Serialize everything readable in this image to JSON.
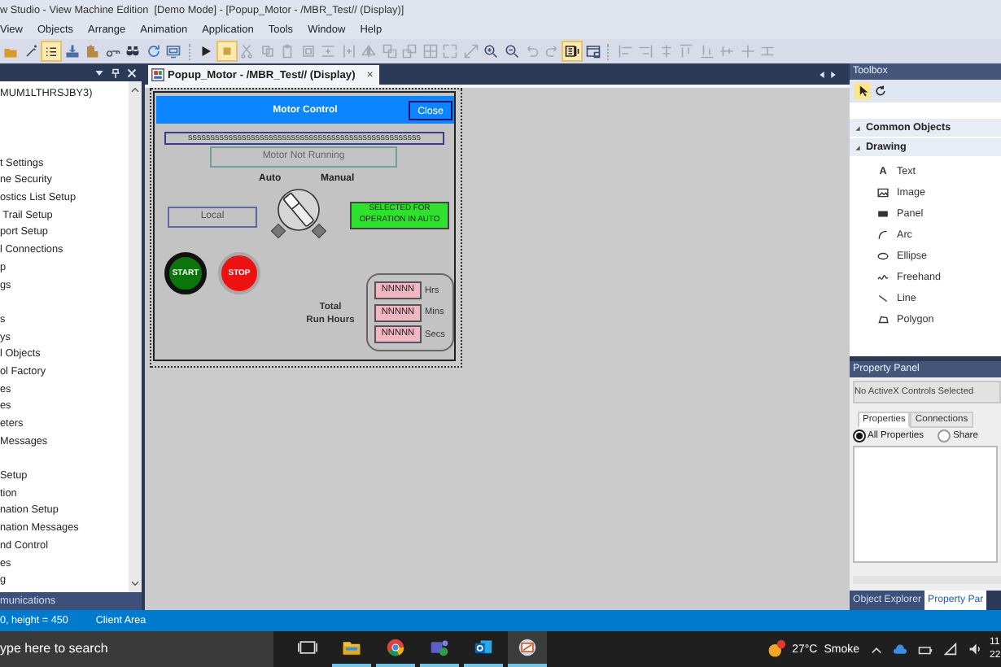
{
  "window": {
    "title": "w Studio - View Machine Edition  [Demo Mode] - [Popup_Motor - /MBR_Test// (Display)]"
  },
  "menu": [
    "View",
    "Objects",
    "Arrange",
    "Animation",
    "Application",
    "Tools",
    "Window",
    "Help"
  ],
  "toolbar_groups": [
    {
      "buttons": [
        {
          "kind": "folder",
          "selected": false,
          "disabled": false
        },
        {
          "kind": "wand",
          "selected": false,
          "disabled": false
        },
        {
          "kind": "list",
          "selected": true,
          "disabled": false
        },
        {
          "kind": "import",
          "selected": false,
          "disabled": false
        },
        {
          "kind": "clipboard",
          "selected": false,
          "disabled": false
        },
        {
          "kind": "key",
          "selected": false,
          "disabled": false
        },
        {
          "kind": "binoculars",
          "selected": false,
          "disabled": false
        },
        {
          "kind": "refresh",
          "selected": false,
          "disabled": false
        },
        {
          "kind": "screen",
          "selected": false,
          "disabled": false
        }
      ]
    },
    {
      "buttons": [
        {
          "kind": "play",
          "selected": false,
          "disabled": false
        },
        {
          "kind": "stop",
          "selected": true,
          "disabled": false
        },
        {
          "kind": "scissors",
          "selected": false,
          "disabled": true
        },
        {
          "kind": "copy",
          "selected": false,
          "disabled": true
        },
        {
          "kind": "paste",
          "selected": false,
          "disabled": true
        },
        {
          "kind": "frame",
          "selected": false,
          "disabled": true
        },
        {
          "kind": "vertical-spacing",
          "selected": false,
          "disabled": true
        },
        {
          "kind": "horizontal-spacing",
          "selected": false,
          "disabled": true
        },
        {
          "kind": "flip",
          "selected": false,
          "disabled": true
        },
        {
          "kind": "bring-front",
          "selected": false,
          "disabled": true
        },
        {
          "kind": "send-back",
          "selected": false,
          "disabled": true
        },
        {
          "kind": "grid",
          "selected": false,
          "disabled": true
        },
        {
          "kind": "select",
          "selected": false,
          "disabled": true
        },
        {
          "kind": "resize",
          "selected": false,
          "disabled": true
        },
        {
          "kind": "zoom-in",
          "selected": false,
          "disabled": false
        },
        {
          "kind": "zoom-out",
          "selected": false,
          "disabled": false
        },
        {
          "kind": "undo",
          "selected": false,
          "disabled": true
        },
        {
          "kind": "redo",
          "selected": false,
          "disabled": true
        },
        {
          "kind": "tag",
          "selected": true,
          "disabled": false
        },
        {
          "kind": "window",
          "selected": false,
          "disabled": false
        }
      ]
    },
    {
      "buttons": [
        {
          "kind": "align-left",
          "selected": false,
          "disabled": true
        },
        {
          "kind": "align-right",
          "selected": false,
          "disabled": true
        },
        {
          "kind": "align-center",
          "selected": false,
          "disabled": true
        },
        {
          "kind": "align-top",
          "selected": false,
          "disabled": true
        },
        {
          "kind": "align-bottom",
          "selected": false,
          "disabled": true
        },
        {
          "kind": "align-middle",
          "selected": false,
          "disabled": true
        },
        {
          "kind": "plus",
          "selected": false,
          "disabled": true
        },
        {
          "kind": "distribute",
          "selected": false,
          "disabled": true
        }
      ]
    }
  ],
  "explorer": {
    "groups": [
      {
        "items": [
          "MUM1LTHRSJBY3)"
        ]
      },
      {
        "items": [
          "t Settings",
          "ne Security",
          "ostics List Setup",
          " Trail Setup",
          "port Setup",
          "l Connections",
          "p",
          "gs"
        ]
      },
      {
        "items": [
          "s",
          "ys",
          "l Objects",
          "ol Factory",
          "es",
          "es",
          "eters",
          "Messages"
        ]
      },
      {
        "items": [
          "Setup",
          "tion",
          "nation Setup",
          "nation Messages",
          "nd Control",
          "es",
          "g"
        ]
      }
    ],
    "bottom_tab": "munications"
  },
  "document_tab": {
    "title": "Popup_Motor - /MBR_Test// (Display)",
    "close": "×"
  },
  "display": {
    "header": "Motor Control",
    "close_button": "Close",
    "string_field": "ssssssssssssssssssssssssssssssssssssssssssssssssssss",
    "status": "Motor Not Running",
    "auto_label": "Auto",
    "manual_label": "Manual",
    "switch_in_auto": true,
    "local_label": "Local",
    "mode_indicator": "SELECTED FOR OPERATION IN AUTO",
    "start_button": "START",
    "stop_button": "STOP",
    "run_hours_label": "Total\nRun Hours",
    "run_hours": [
      {
        "value": "NNNNN",
        "unit": "Hrs"
      },
      {
        "value": "NNNNN",
        "unit": "Mins"
      },
      {
        "value": "NNNNN",
        "unit": "Secs"
      }
    ]
  },
  "toolbox": {
    "title": "Toolbox",
    "tools": [
      {
        "kind": "pointer",
        "selected": true
      },
      {
        "kind": "rotate",
        "selected": false
      }
    ],
    "sections": [
      "Common Objects",
      "Drawing"
    ],
    "items": [
      {
        "kind": "text",
        "glyph": "A",
        "label": "Text"
      },
      {
        "kind": "image",
        "label": "Image"
      },
      {
        "kind": "panel",
        "label": "Panel"
      },
      {
        "kind": "arc",
        "label": "Arc"
      },
      {
        "kind": "ellipse",
        "label": "Ellipse"
      },
      {
        "kind": "freehand",
        "label": "Freehand"
      },
      {
        "kind": "line",
        "label": "Line"
      },
      {
        "kind": "polygon",
        "label": "Polygon"
      }
    ]
  },
  "property_panel": {
    "title": "Property Panel",
    "selection": "No ActiveX Controls Selected",
    "tabs": [
      {
        "label": "Properties",
        "selected": true
      },
      {
        "label": "Connections",
        "selected": false
      }
    ],
    "filters": [
      {
        "label": "All Properties",
        "selected": true
      },
      {
        "label": "Share",
        "selected": false
      }
    ]
  },
  "bottom_tabs": [
    {
      "label": "Object Explorer",
      "selected": false
    },
    {
      "label": "Property Par",
      "selected": true
    }
  ],
  "status_bar": {
    "size": "0, height = 450",
    "area": "Client Area"
  },
  "taskbar": {
    "search_placeholder": "ype here to search",
    "apps": [
      {
        "kind": "task-view",
        "running": false,
        "active": false
      },
      {
        "kind": "folder",
        "running": true,
        "active": false
      },
      {
        "kind": "browser",
        "running": true,
        "active": false
      },
      {
        "kind": "people",
        "running": true,
        "active": false
      },
      {
        "kind": "mail",
        "running": true,
        "active": false
      },
      {
        "kind": "monitor",
        "running": true,
        "active": true
      }
    ],
    "temperature": "27°C",
    "condition": "Smoke",
    "time": "11",
    "date": "22"
  }
}
